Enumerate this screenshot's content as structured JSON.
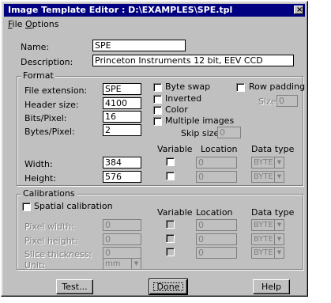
{
  "window": {
    "title": "Image Template Editor : D:\\EXAMPLES\\SPE.tpl",
    "close": "×"
  },
  "menu": {
    "file": "File",
    "options": "Options"
  },
  "name": {
    "label": "Name:",
    "value": "SPE"
  },
  "description": {
    "label": "Description:",
    "value": "Princeton Instruments 12 bit, EEV CCD"
  },
  "format": {
    "title": "Format",
    "file_extension": {
      "label": "File extension:",
      "value": "SPE"
    },
    "header_size": {
      "label": "Header size:",
      "value": "4100"
    },
    "bits_pixel": {
      "label": "Bits/Pixel:",
      "value": "16"
    },
    "bytes_pixel": {
      "label": "Bytes/Pixel:",
      "value": "2"
    },
    "byte_swap": "Byte swap",
    "inverted": "Inverted",
    "color": "Color",
    "multiple_images": "Multiple images",
    "skip_size": {
      "label": "Skip size:",
      "value": "0"
    },
    "row_padding": "Row padding",
    "size": {
      "label": "Size:",
      "value": "0"
    },
    "col_variable": "Variable",
    "col_location": "Location",
    "col_datatype": "Data type",
    "width": {
      "label": "Width:",
      "value": "384",
      "location": "0",
      "datatype": "BYTE"
    },
    "height": {
      "label": "Height:",
      "value": "576",
      "location": "0",
      "datatype": "BYTE"
    }
  },
  "calibrations": {
    "title": "Calibrations",
    "spatial": "Spatial calibration",
    "col_variable": "Variable",
    "col_location": "Location",
    "col_datatype": "Data type",
    "pixel_width": {
      "label": "Pixel width:",
      "value": "0",
      "location": "0",
      "datatype": "BYTE"
    },
    "pixel_height": {
      "label": "Pixel height:",
      "value": "0",
      "location": "0",
      "datatype": "BYTE"
    },
    "slice_thickness": {
      "label": "Slice thickness:",
      "value": "0",
      "location": "0",
      "datatype": "BYTE"
    },
    "unit": {
      "label": "Unit:",
      "value": "mm"
    }
  },
  "buttons": {
    "test": "Test...",
    "done": "Done",
    "help": "Help"
  }
}
